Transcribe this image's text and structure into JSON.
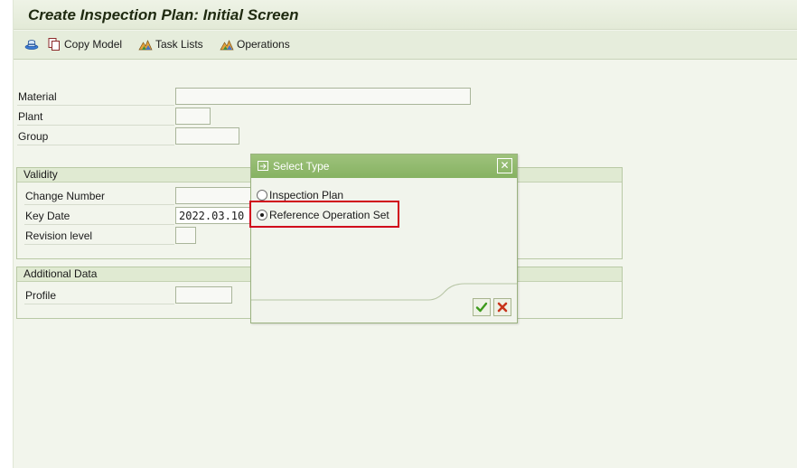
{
  "window": {
    "title": "Create Inspection Plan: Initial Screen"
  },
  "toolbar": {
    "items": [
      {
        "label": "",
        "icon": "hat-icon"
      },
      {
        "label": "Copy Model",
        "icon": "copy-icon"
      },
      {
        "label": "Task Lists",
        "icon": "mountain-icon"
      },
      {
        "label": "Operations",
        "icon": "mountain-icon"
      }
    ]
  },
  "form": {
    "material": {
      "label": "Material",
      "value": ""
    },
    "plant": {
      "label": "Plant",
      "value": ""
    },
    "group": {
      "label": "Group",
      "value": ""
    }
  },
  "validity": {
    "title": "Validity",
    "change_number": {
      "label": "Change Number",
      "value": ""
    },
    "key_date": {
      "label": "Key Date",
      "value": "2022.03.10"
    },
    "revision_level": {
      "label": "Revision level",
      "value": ""
    }
  },
  "additional_data": {
    "title": "Additional Data",
    "profile": {
      "label": "Profile",
      "value": ""
    }
  },
  "dialog": {
    "title": "Select Type",
    "options": [
      {
        "label": "Inspection Plan",
        "selected": false
      },
      {
        "label": "Reference Operation Set",
        "selected": true
      }
    ],
    "confirm_icon": "checkmark-icon",
    "cancel_icon": "cancel-icon",
    "close_glyph": "✕"
  },
  "colors": {
    "accent": "#86b262",
    "highlight": "#d0021b",
    "confirm": "#3d9a1c",
    "cancel": "#c8341c"
  }
}
